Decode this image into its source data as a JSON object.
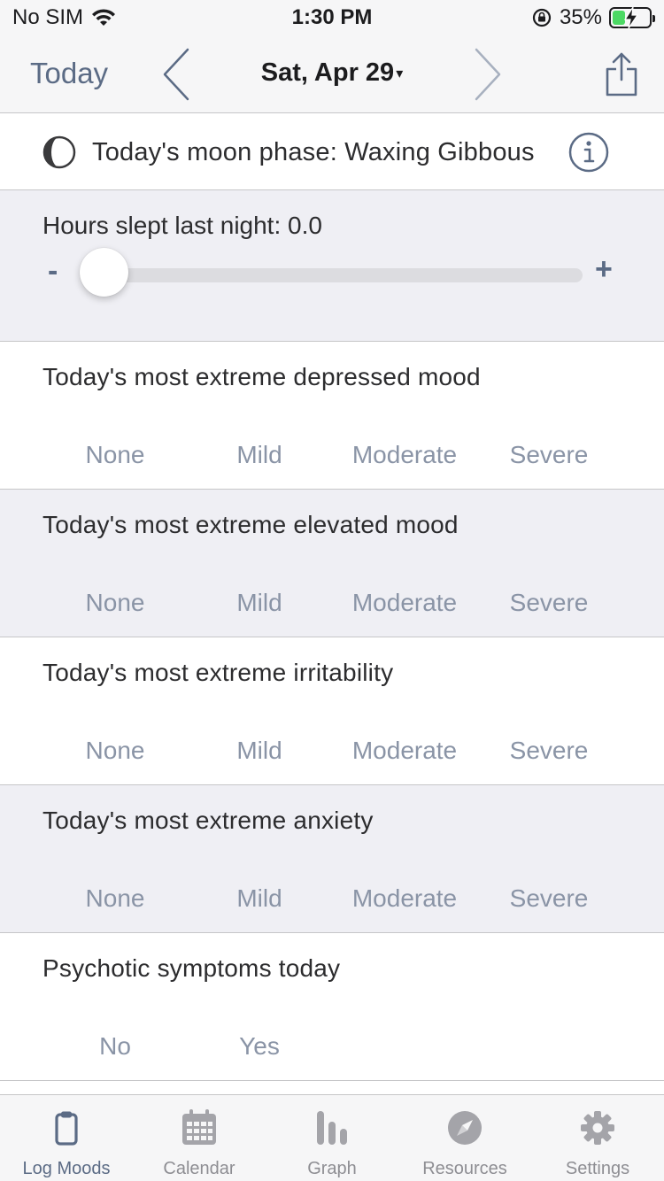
{
  "status_bar": {
    "carrier": "No SIM",
    "time": "1:30 PM",
    "battery": "35%",
    "battery_level": 0.35,
    "wifi_icon": "wifi-icon",
    "lock_icon": "orientation-lock-icon"
  },
  "nav": {
    "today_label": "Today",
    "date_label": "Sat, Apr 29",
    "date_caret": "▾",
    "prev_icon": "chevron-left-icon",
    "next_icon": "chevron-right-icon",
    "share_icon": "share-icon"
  },
  "moon": {
    "text": "Today's moon phase: Waxing Gibbous",
    "icon": "moon-phase-icon",
    "info_icon": "info-icon"
  },
  "sleep": {
    "label": "Hours slept last night: 0.0",
    "minus": "-",
    "plus": "+",
    "value": 0.0
  },
  "questions": [
    {
      "title": "Today's most extreme depressed mood",
      "options": [
        "None",
        "Mild",
        "Moderate",
        "Severe"
      ]
    },
    {
      "title": "Today's most extreme elevated mood",
      "options": [
        "None",
        "Mild",
        "Moderate",
        "Severe"
      ]
    },
    {
      "title": "Today's most extreme irritability",
      "options": [
        "None",
        "Mild",
        "Moderate",
        "Severe"
      ]
    },
    {
      "title": "Today's most extreme anxiety",
      "options": [
        "None",
        "Mild",
        "Moderate",
        "Severe"
      ]
    },
    {
      "title": "Psychotic symptoms today",
      "options": [
        "No",
        "Yes"
      ]
    }
  ],
  "tabs": [
    {
      "label": "Log Moods",
      "icon": "clipboard-icon",
      "active": true
    },
    {
      "label": "Calendar",
      "icon": "calendar-icon",
      "active": false
    },
    {
      "label": "Graph",
      "icon": "bar-graph-icon",
      "active": false
    },
    {
      "label": "Resources",
      "icon": "compass-icon",
      "active": false
    },
    {
      "label": "Settings",
      "icon": "gear-icon",
      "active": false
    }
  ],
  "colors": {
    "accent": "#5b6b85",
    "option_text": "#8a94a6",
    "row_alt_bg": "#efeff4",
    "battery_green": "#4cd964"
  }
}
